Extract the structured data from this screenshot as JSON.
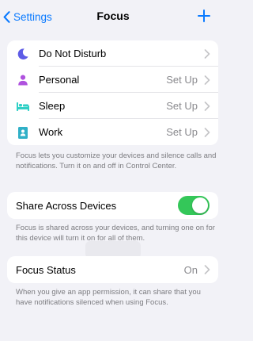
{
  "nav": {
    "back_label": "Settings",
    "title": "Focus"
  },
  "modes": [
    {
      "label": "Do Not Disturb",
      "value": "",
      "icon": "moon-icon",
      "color": "#5e5ce6"
    },
    {
      "label": "Personal",
      "value": "Set Up",
      "icon": "person-icon",
      "color": "#af52de"
    },
    {
      "label": "Sleep",
      "value": "Set Up",
      "icon": "bed-icon",
      "color": "#30d0c6"
    },
    {
      "label": "Work",
      "value": "Set Up",
      "icon": "id-badge-icon",
      "color": "#30b0c7"
    }
  ],
  "focus_footer": "Focus lets you customize your devices and silence calls and notifications. Turn it on and off in Control Center.",
  "share": {
    "label": "Share Across Devices",
    "enabled": true,
    "footer": "Focus is shared across your devices, and turning one on for this device will turn it on for all of them."
  },
  "status": {
    "label": "Focus Status",
    "value": "On",
    "footer": "When you give an app permission, it can share that you have notifications silenced when using Focus."
  },
  "colors": {
    "accent": "#0a7aff",
    "toggle_on": "#34c759"
  }
}
